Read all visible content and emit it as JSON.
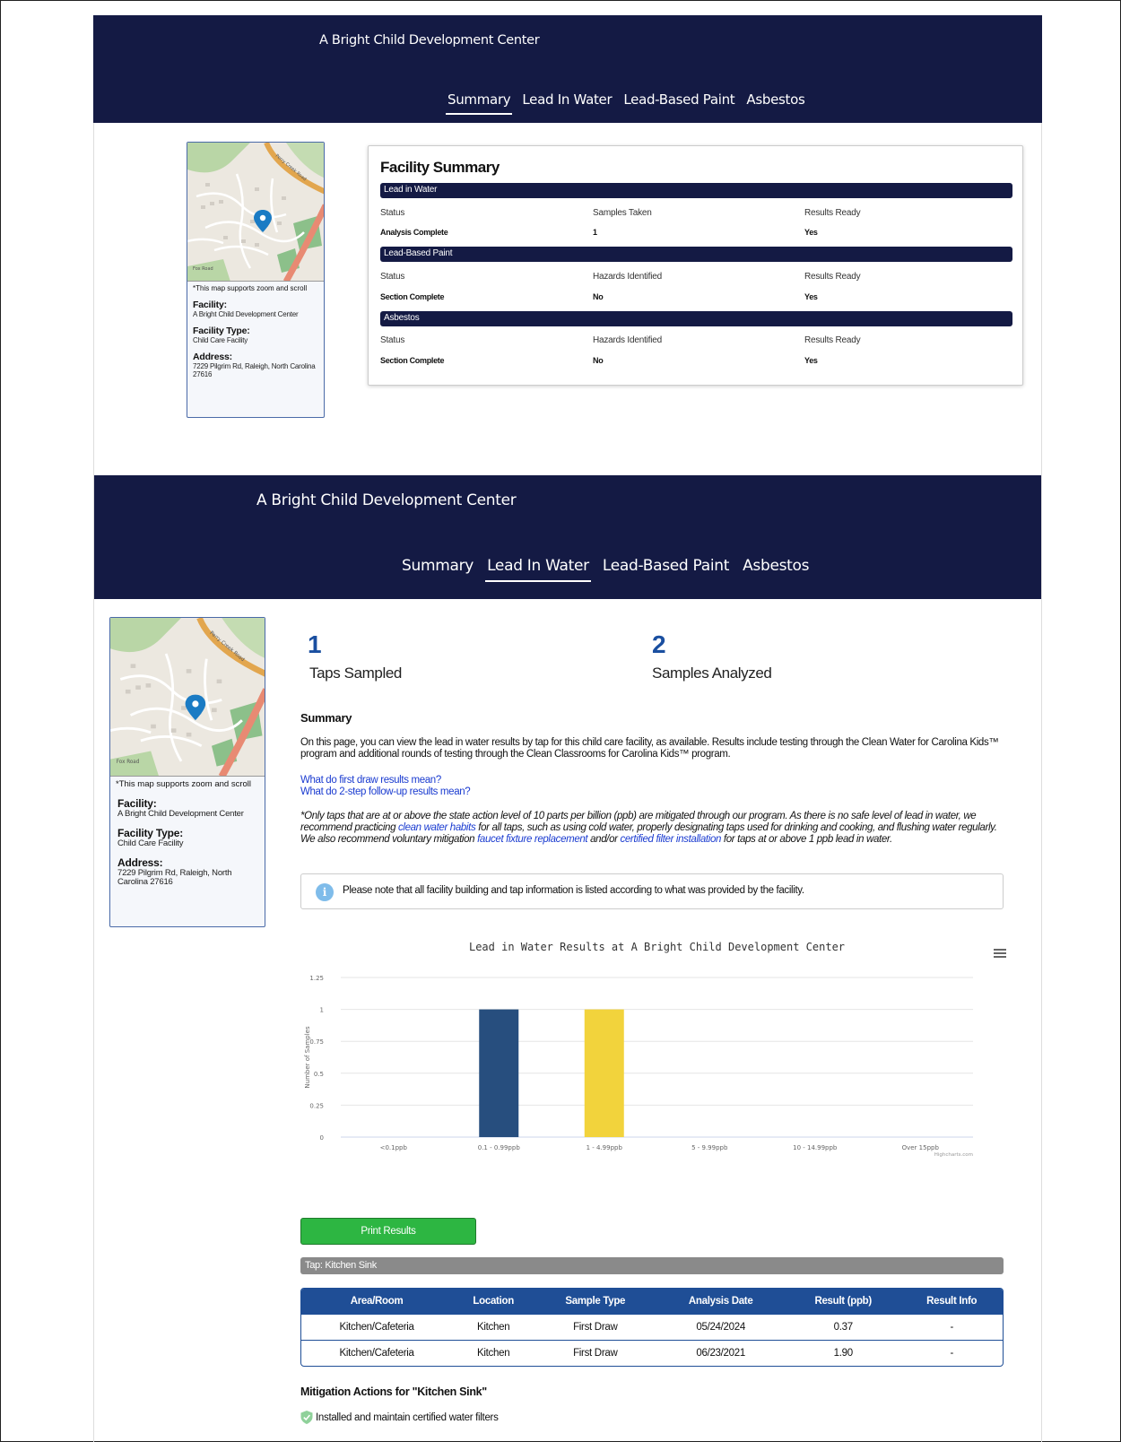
{
  "facility_name": "A Bright Child Development Center",
  "tabs": [
    "Summary",
    "Lead In Water",
    "Lead-Based Paint",
    "Asbestos"
  ],
  "map": {
    "road_label": "Fox Road",
    "road_label_2": "Perry Creek Road",
    "note": "*This map supports zoom and scroll"
  },
  "meta": {
    "facility_label": "Facility:",
    "facility_value": "A Bright Child Development Center",
    "type_label": "Facility Type:",
    "type_value": "Child Care Facility",
    "address_label": "Address:",
    "address_value": "7229 Pilgrim Rd, Raleigh, North Carolina 27616"
  },
  "facility_summary": {
    "title": "Facility Summary",
    "sections": [
      {
        "name": "Lead in Water",
        "headers": [
          "Status",
          "Samples Taken",
          "Results Ready"
        ],
        "values": [
          "Analysis Complete",
          "1",
          "Yes"
        ]
      },
      {
        "name": "Lead-Based Paint",
        "headers": [
          "Status",
          "Hazards Identified",
          "Results Ready"
        ],
        "values": [
          "Section Complete",
          "No",
          "Yes"
        ]
      },
      {
        "name": "Asbestos",
        "headers": [
          "Status",
          "Hazards Identified",
          "Results Ready"
        ],
        "values": [
          "Section Complete",
          "No",
          "Yes"
        ]
      }
    ]
  },
  "stats": {
    "taps_sampled": "1",
    "taps_sampled_label": "Taps Sampled",
    "samples_analyzed": "2",
    "samples_analyzed_label": "Samples Analyzed"
  },
  "summary": {
    "heading": "Summary",
    "paragraph": "On this page, you can view the lead in water results by tap for this child care facility, as available. Results include testing through the Clean Water for Carolina Kids™ program and additional rounds of testing through the Clean Classrooms for Carolina Kids™ program.",
    "link_first_draw": "What do first draw results mean?",
    "link_two_step": "What do 2-step follow-up results mean?",
    "note_part1": "*Only taps that are at or above the state action level of 10 parts per billion (ppb) are mitigated through our program. As there is no safe level of lead in water, we recommend practicing ",
    "note_link1": "clean water habits",
    "note_part2": " for all taps, such as using cold water, properly designating taps used for drinking and cooking, and flushing water regularly. We also recommend voluntary mitigation ",
    "note_link2": "faucet fixture replacement",
    "note_part3": " and/or ",
    "note_link3": "certified filter installation",
    "note_part4": " for taps at or above 1 ppb lead in water.",
    "info_icon": "i",
    "info": "Please note that all facility building and tap information is listed according to what was provided by the facility."
  },
  "chart_data": {
    "type": "bar",
    "title": "Lead in Water Results at A Bright Child Development Center",
    "ylabel": "Number of Samples",
    "xlabel": "",
    "categories": [
      "<0.1ppb",
      "0.1 - 0.99ppb",
      "1 - 4.99ppb",
      "5 - 9.99ppb",
      "10 - 14.99ppb",
      "Over 15ppb"
    ],
    "values": [
      0,
      1,
      1,
      0,
      0,
      0
    ],
    "colors": [
      "#274e7e",
      "#274e7e",
      "#f2d33c",
      "#274e7e",
      "#274e7e",
      "#274e7e"
    ],
    "ylim": [
      0,
      1.25
    ],
    "yticks": [
      "0",
      "0.25",
      "0.5",
      "0.75",
      "1",
      "1.25"
    ],
    "credit": "Highcharts.com",
    "grid": true,
    "legend": "none"
  },
  "print_button": "Print Results",
  "tap": {
    "label": "Tap: Kitchen Sink",
    "columns": [
      "Area/Room",
      "Location",
      "Sample Type",
      "Analysis Date",
      "Result (ppb)",
      "Result Info"
    ],
    "rows": [
      [
        "Kitchen/Cafeteria",
        "Kitchen",
        "First Draw",
        "05/24/2024",
        "0.37",
        "-"
      ],
      [
        "Kitchen/Cafeteria",
        "Kitchen",
        "First Draw",
        "06/23/2021",
        "1.90",
        "-"
      ]
    ]
  },
  "mitigation": {
    "heading": "Mitigation Actions for \"Kitchen Sink\"",
    "item": "Installed and maintain certified water filters"
  },
  "colors": {
    "navy": "#141a44",
    "link": "#1a3bd0",
    "green": "#2db642",
    "table_blue": "#1f4e96",
    "stat_blue": "#1a4fa0"
  }
}
